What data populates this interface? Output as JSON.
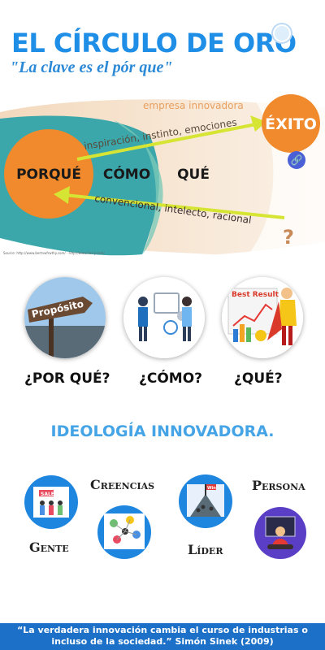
{
  "header": {
    "title": "EL CÍRCULO DE ORO",
    "subtitle": "\"La clave es el pór que\""
  },
  "diagram": {
    "top_label": "empresa innovadora",
    "upper_path_label": "inspiración, instinto, emociones",
    "lower_path_label": "convencional, intelecto, racional",
    "success_label": "ÉXITO",
    "core_label": "PORQUÉ",
    "middle_label": "CÓMO",
    "outer_label": "QUÉ",
    "question_mark": "?",
    "source": "Source: http://www.bertnwfrwthy.com/ · http://www.harry.com/",
    "colors": {
      "orange": "#f08a2c",
      "teal": "#3ba7ab",
      "beige": "#f3d9bd",
      "arrow": "#d6e534"
    }
  },
  "columns": {
    "icons": [
      "purpose-sign-icon",
      "team-collaboration-icon",
      "best-result-chart-icon"
    ],
    "sign_text": "Propósito",
    "chart_text": "Best Result",
    "labels": [
      "¿POR QUÉ?",
      "¿CÓMO?",
      "¿QUÉ?"
    ]
  },
  "ideology": {
    "heading": "IDEOLOGÍA INNOVADORA.",
    "labels": {
      "creencias": "Creencias",
      "persona": "Persona",
      "gente": "Gente",
      "lider": "Líder"
    },
    "icons": [
      "sale-crowd-icon",
      "network-people-icon",
      "leader-mountain-icon",
      "meditating-person-icon"
    ],
    "sale_text": "SALE",
    "flag_text": "Win"
  },
  "footer": {
    "quote": "“La verdadera innovación cambia el curso de industrias o incluso de la sociedad.” Simón Sinek (2009)"
  }
}
